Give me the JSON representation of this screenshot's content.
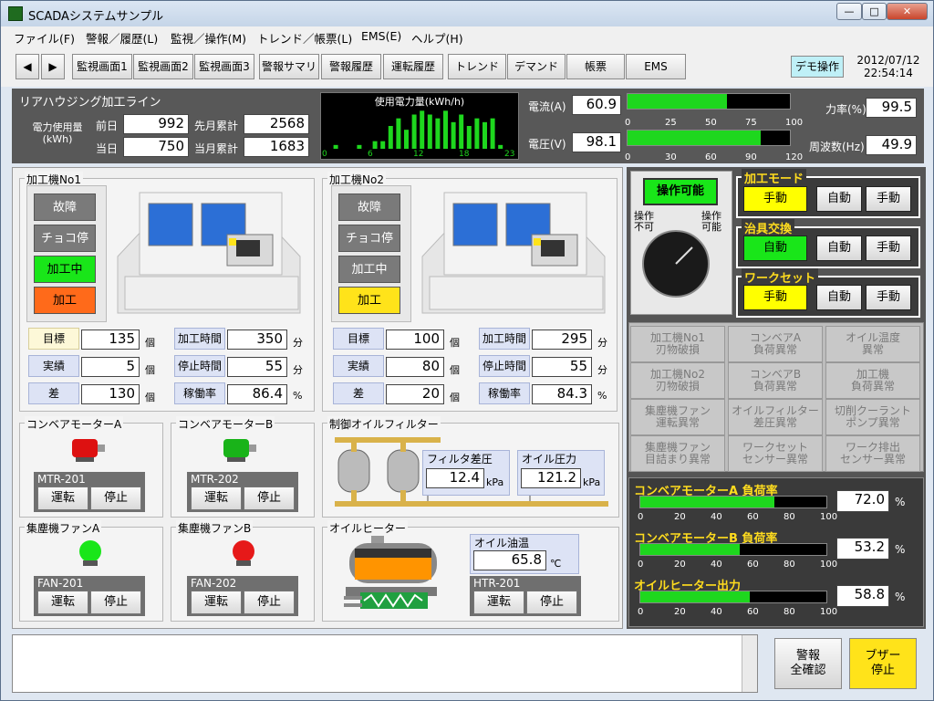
{
  "window": {
    "title": "SCADAシステムサンプル",
    "min": "—",
    "max": "□",
    "close": "✕"
  },
  "menu": [
    "ファイル(F)",
    "警報／履歴(L)",
    "監視／操作(M)",
    "トレンド／帳票(L)",
    "EMS(E)",
    "ヘルプ(H)"
  ],
  "toolbar": {
    "prev": "◀",
    "next": "▶",
    "buttons": [
      "監視画面1",
      "監視画面2",
      "監視画面3",
      "警報サマリ",
      "警報履歴",
      "運転履歴",
      "トレンド",
      "デマンド",
      "帳票",
      "EMS"
    ],
    "demo": "デモ操作",
    "date": "2012/07/12",
    "time": "22:54:14"
  },
  "top": {
    "line_title": "リアハウジング加工ライン",
    "power_label": "電力使用量\n(kWh)",
    "prev_day_label": "前日",
    "prev_day": "992",
    "today_label": "当日",
    "today": "750",
    "prev_month_label": "先月累計",
    "prev_month": "2568",
    "this_month_label": "当月累計",
    "this_month": "1683",
    "chart_title": "使用電力量(kWh/h)",
    "chart_ticks": [
      "0",
      "6",
      "12",
      "18",
      "23"
    ],
    "current_label": "電流(A)",
    "current": "60.9",
    "current_pct": 61,
    "current_scale": [
      "0",
      "25",
      "50",
      "75",
      "100"
    ],
    "voltage_label": "電圧(V)",
    "voltage": "98.1",
    "voltage_pct": 82,
    "voltage_scale": [
      "0",
      "30",
      "60",
      "90",
      "120"
    ],
    "pf_label": "力率(%)",
    "pf": "99.5",
    "freq_label": "周波数(Hz)",
    "freq": "49.9"
  },
  "chart_data": {
    "type": "bar",
    "categories": [
      "0",
      "1",
      "2",
      "3",
      "4",
      "5",
      "6",
      "7",
      "8",
      "9",
      "10",
      "11",
      "12",
      "13",
      "14",
      "15",
      "16",
      "17",
      "18",
      "19",
      "20",
      "21",
      "22",
      "23"
    ],
    "values": [
      0,
      1,
      0,
      0,
      1,
      0,
      2,
      2,
      6,
      8,
      5,
      9,
      10,
      9,
      8,
      10,
      7,
      9,
      6,
      8,
      7,
      8,
      1,
      0
    ]
  },
  "m1": {
    "title": "加工機No1",
    "states": [
      "故障",
      "チョコ停",
      "加工中",
      "加工"
    ],
    "target_label": "目標",
    "target": "135",
    "actual_label": "実績",
    "actual": "5",
    "diff_label": "差",
    "diff": "130",
    "unit_pc": "個",
    "proc_label": "加工時間",
    "proc": "350",
    "stop_label": "停止時間",
    "stop": "55",
    "rate_label": "稼働率",
    "rate": "86.4",
    "unit_min": "分",
    "unit_pct": "%"
  },
  "m2": {
    "title": "加工機No2",
    "states": [
      "故障",
      "チョコ停",
      "加工中",
      "加工"
    ],
    "target_label": "目標",
    "target": "100",
    "actual_label": "実績",
    "actual": "80",
    "diff_label": "差",
    "diff": "20",
    "unit_pc": "個",
    "proc_label": "加工時間",
    "proc": "295",
    "stop_label": "停止時間",
    "stop": "55",
    "rate_label": "稼働率",
    "rate": "84.3",
    "unit_min": "分",
    "unit_pct": "%"
  },
  "devices": [
    {
      "title": "コンベアモーターA",
      "id": "MTR-201"
    },
    {
      "title": "コンベアモーターB",
      "id": "MTR-202"
    },
    {
      "title": "集塵機ファンA",
      "id": "FAN-201"
    },
    {
      "title": "集塵機ファンB",
      "id": "FAN-202"
    }
  ],
  "run": "運転",
  "stop": "停止",
  "filter": {
    "title": "制御オイルフィルター",
    "dp_label": "フィルタ差圧",
    "dp": "12.4",
    "dp_unit": "kPa",
    "op_label": "オイル圧力",
    "op": "121.2",
    "op_unit": "kPa"
  },
  "heater": {
    "title": "オイルヒーター",
    "temp_label": "オイル油温",
    "temp": "65.8",
    "temp_unit": "℃",
    "id": "HTR-201"
  },
  "ops": {
    "enable": "操作可能",
    "left": "操作\n不可",
    "right": "操作\n可能"
  },
  "modes": [
    {
      "title": "加工モード",
      "selected": "手動",
      "auto": "自動",
      "manual": "手動"
    },
    {
      "title": "治具交換",
      "selected": "自動",
      "auto": "自動",
      "manual": "手動"
    },
    {
      "title": "ワークセット",
      "selected": "手動",
      "auto": "自動",
      "manual": "手動"
    }
  ],
  "alarms": [
    "加工機No1\n刃物破損",
    "コンベアA\n負荷異常",
    "オイル温度\n異常",
    "加工機No2\n刃物破損",
    "コンベアB\n負荷異常",
    "加工機\n負荷異常",
    "集塵機ファン\n運転異常",
    "オイルフィルター\n差圧異常",
    "切削クーラント\nポンプ異常",
    "集塵機ファン\n目詰まり異常",
    "ワークセット\nセンサー異常",
    "ワーク排出\nセンサー異常"
  ],
  "loads": [
    {
      "title": "コンベアモーターA 負荷率",
      "value": "72.0",
      "pct": 72
    },
    {
      "title": "コンベアモーターB 負荷率",
      "value": "53.2",
      "pct": 53.2
    },
    {
      "title": "オイルヒーター出力",
      "value": "58.8",
      "pct": 58.8
    }
  ],
  "load_scale": [
    "0",
    "20",
    "40",
    "60",
    "80",
    "100"
  ],
  "load_unit": "%",
  "footer": {
    "ack": "警報\n全確認",
    "buzzer": "ブザー\n停止"
  },
  "colors": {
    "fault_bg": "#7a7a7a",
    "running": "#19e619",
    "processing_orange": "#ff6a1a",
    "processing_yellow": "#ffe31a",
    "mode_yellow": "#ffff00",
    "mode_green": "#19e619"
  }
}
